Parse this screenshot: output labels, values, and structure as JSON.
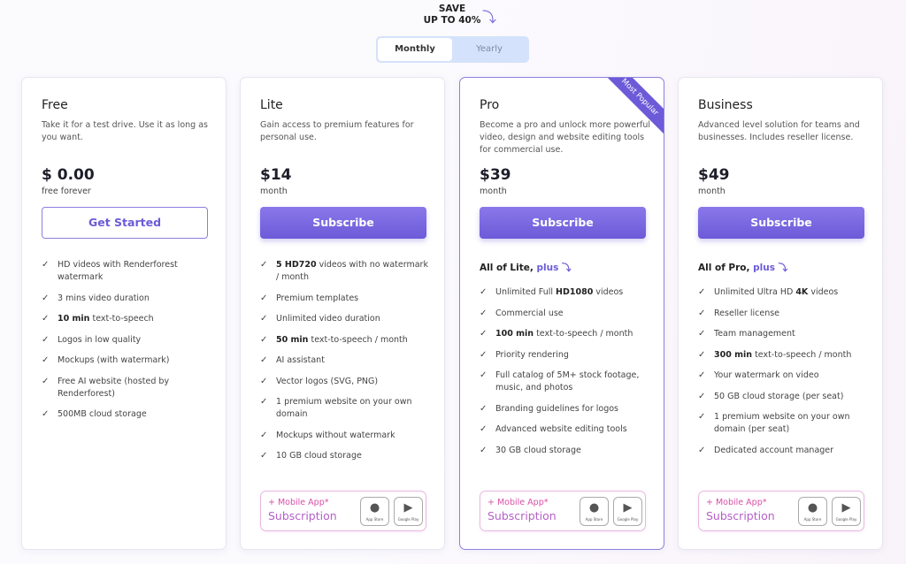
{
  "promo": {
    "save": "SAVE",
    "upto": "UP TO 40%"
  },
  "toggle": {
    "monthly": "Monthly",
    "yearly": "Yearly",
    "selected": "Monthly"
  },
  "colors": {
    "accent": "#6c5ad8",
    "toggle_bg": "#d5e2fb",
    "mobile_pink": "#d94fa6"
  },
  "plans": [
    {
      "name": "Free",
      "desc": "Take it for a test drive. Use it as long as you want.",
      "price": "$ 0.00",
      "period": "free forever",
      "button": "Get Started",
      "plus_prefix": "",
      "plus_word": "",
      "features": [
        [
          [
            "",
            "HD videos with Renderforest watermark"
          ]
        ],
        [
          [
            "",
            "3 mins video duration"
          ]
        ],
        [
          [
            "b",
            "10 min"
          ],
          [
            "",
            " text-to-speech"
          ]
        ],
        [
          [
            "",
            "Logos in low quality"
          ]
        ],
        [
          [
            "",
            "Mockups (with watermark)"
          ]
        ],
        [
          [
            "",
            "Free AI website (hosted by Renderforest)"
          ]
        ],
        [
          [
            "",
            "500MB cloud storage"
          ]
        ]
      ]
    },
    {
      "name": "Lite",
      "desc": "Gain access to premium features for personal use.",
      "price": "$14",
      "period": "month",
      "button": "Subscribe",
      "plus_prefix": "",
      "plus_word": "",
      "features": [
        [
          [
            "b",
            "5 HD720"
          ],
          [
            "",
            " videos with no watermark / month"
          ]
        ],
        [
          [
            "",
            "Premium templates"
          ]
        ],
        [
          [
            "",
            "Unlimited video duration"
          ]
        ],
        [
          [
            "b",
            "50 min"
          ],
          [
            "",
            " text-to-speech / month"
          ]
        ],
        [
          [
            "",
            "AI assistant"
          ]
        ],
        [
          [
            "",
            "Vector logos (SVG, PNG)"
          ]
        ],
        [
          [
            "",
            "1 premium website on your own domain"
          ]
        ],
        [
          [
            "",
            "Mockups without watermark"
          ]
        ],
        [
          [
            "",
            "10 GB cloud storage"
          ]
        ]
      ]
    },
    {
      "name": "Pro",
      "desc": "Become a pro and unlock more powerful video, design and website editing tools for commercial use.",
      "price": "$39",
      "period": "month",
      "button": "Subscribe",
      "badge": "Most Popular",
      "plus_prefix": "All of Lite, ",
      "plus_word": "plus",
      "features": [
        [
          [
            "",
            "Unlimited Full "
          ],
          [
            "b",
            "HD1080"
          ],
          [
            "",
            " videos"
          ]
        ],
        [
          [
            "",
            "Commercial use"
          ]
        ],
        [
          [
            "b",
            "100 min"
          ],
          [
            "",
            " text-to-speech / month"
          ]
        ],
        [
          [
            "",
            "Priority rendering"
          ]
        ],
        [
          [
            "",
            "Full catalog of 5M+ stock footage, music, and photos"
          ]
        ],
        [
          [
            "",
            "Branding guidelines for logos"
          ]
        ],
        [
          [
            "",
            "Advanced website editing tools"
          ]
        ],
        [
          [
            "",
            "30 GB cloud storage"
          ]
        ]
      ]
    },
    {
      "name": "Business",
      "desc": "Advanced level solution for teams and businesses. Includes reseller license.",
      "price": "$49",
      "period": "month",
      "button": "Subscribe",
      "plus_prefix": "All of Pro, ",
      "plus_word": "plus",
      "features": [
        [
          [
            "",
            "Unlimited Ultra HD "
          ],
          [
            "b",
            "4K"
          ],
          [
            "",
            " videos"
          ]
        ],
        [
          [
            "",
            "Reseller license"
          ]
        ],
        [
          [
            "",
            "Team management"
          ]
        ],
        [
          [
            "b",
            "300 min"
          ],
          [
            "",
            " text-to-speech / month"
          ]
        ],
        [
          [
            "",
            "Your watermark on video"
          ]
        ],
        [
          [
            "",
            "50 GB cloud storage (per seat)"
          ]
        ],
        [
          [
            "",
            "1 premium website on your own domain (per seat)"
          ]
        ],
        [
          [
            "",
            "Dedicated account manager"
          ]
        ]
      ]
    }
  ],
  "mobile": {
    "line1": "+ Mobile App*",
    "line2": "Subscription",
    "app_store": "App Store",
    "google_play": "Google Play"
  }
}
